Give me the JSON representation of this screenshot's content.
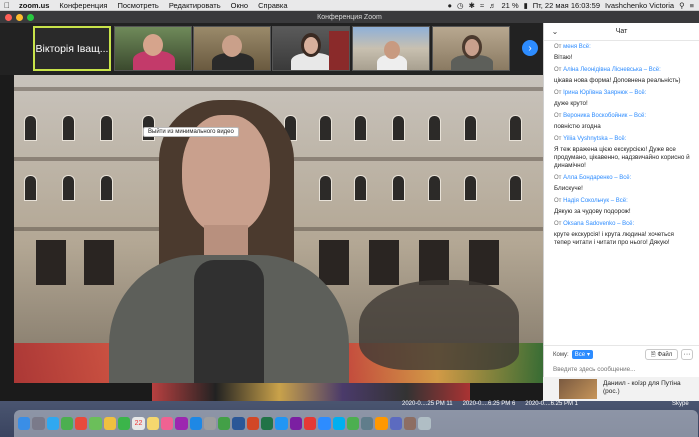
{
  "menubar": {
    "apple_icon": "apple-icon",
    "app_name": "zoom.us",
    "items": [
      "Конференция",
      "Посмотреть",
      "Редактировать",
      "Окно",
      "Справка"
    ],
    "battery": "21 %",
    "datetime": "Пт, 22 мая  16:03:59",
    "user": "Ivashchenko Victoria"
  },
  "window": {
    "title": "Конференция Zoom"
  },
  "filmstrip": {
    "active_name": "Вікторія Іващ..."
  },
  "main_video": {
    "tooltip": "Выйти из минимального видео"
  },
  "chat": {
    "title": "Чат",
    "messages": [
      {
        "prefix": "От ",
        "sender": "меня",
        "suffix": " Всё:",
        "text": "Вітаю!"
      },
      {
        "prefix": "От ",
        "sender": "Аліна Леонідівна Лісневська",
        "suffix": " – Всё:",
        "text": "цікава нова форма! Доповнена реальність)"
      },
      {
        "prefix": "От ",
        "sender": "Ірина Юріївна Заярнюк",
        "suffix": " – Всё:",
        "text": "дуже круто!"
      },
      {
        "prefix": "От ",
        "sender": "Вероника Воскобойник",
        "suffix": " – Всё:",
        "text": "повністю згодна"
      },
      {
        "prefix": "От ",
        "sender": "Yiliia Vyshnytska",
        "suffix": " – Всё:",
        "text": "Я теж вражена цією екскурсією! Дуже все продумано, цікавенно, надзвичайно корисно й динамічно!"
      },
      {
        "prefix": "От ",
        "sender": "Алла Бондаренко",
        "suffix": " – Всё:",
        "text": "Блискуче!"
      },
      {
        "prefix": "От ",
        "sender": "Надія Сокольчук",
        "suffix": " – Всё:",
        "text": "Дякую за чудову подорож!"
      },
      {
        "prefix": "От ",
        "sender": "Oksana Sadovenko",
        "suffix": " – Всё:",
        "text": "круте екскурсія! і крута людина! хочеться тепер читати і читати про нього! Дякую!"
      }
    ],
    "to_label": "Кому:",
    "to_value": "Все",
    "file_label": "Файл",
    "more_label": "···",
    "input_placeholder": "Введите здесь сообщение..."
  },
  "background_window": {
    "text": "Даниил - коїзр для Путіна (рос.)"
  },
  "desktop": {
    "file_labels": [
      "2020-0....25 PM 11",
      "2020-0....6.25 PM 6",
      "2020-0....6.25 PM 1"
    ],
    "skype_label": "Skype"
  },
  "colors": {
    "accent": "#2d8cff",
    "active_speaker_border": "#c8e34a",
    "window_chrome": "#3a3a3c"
  }
}
